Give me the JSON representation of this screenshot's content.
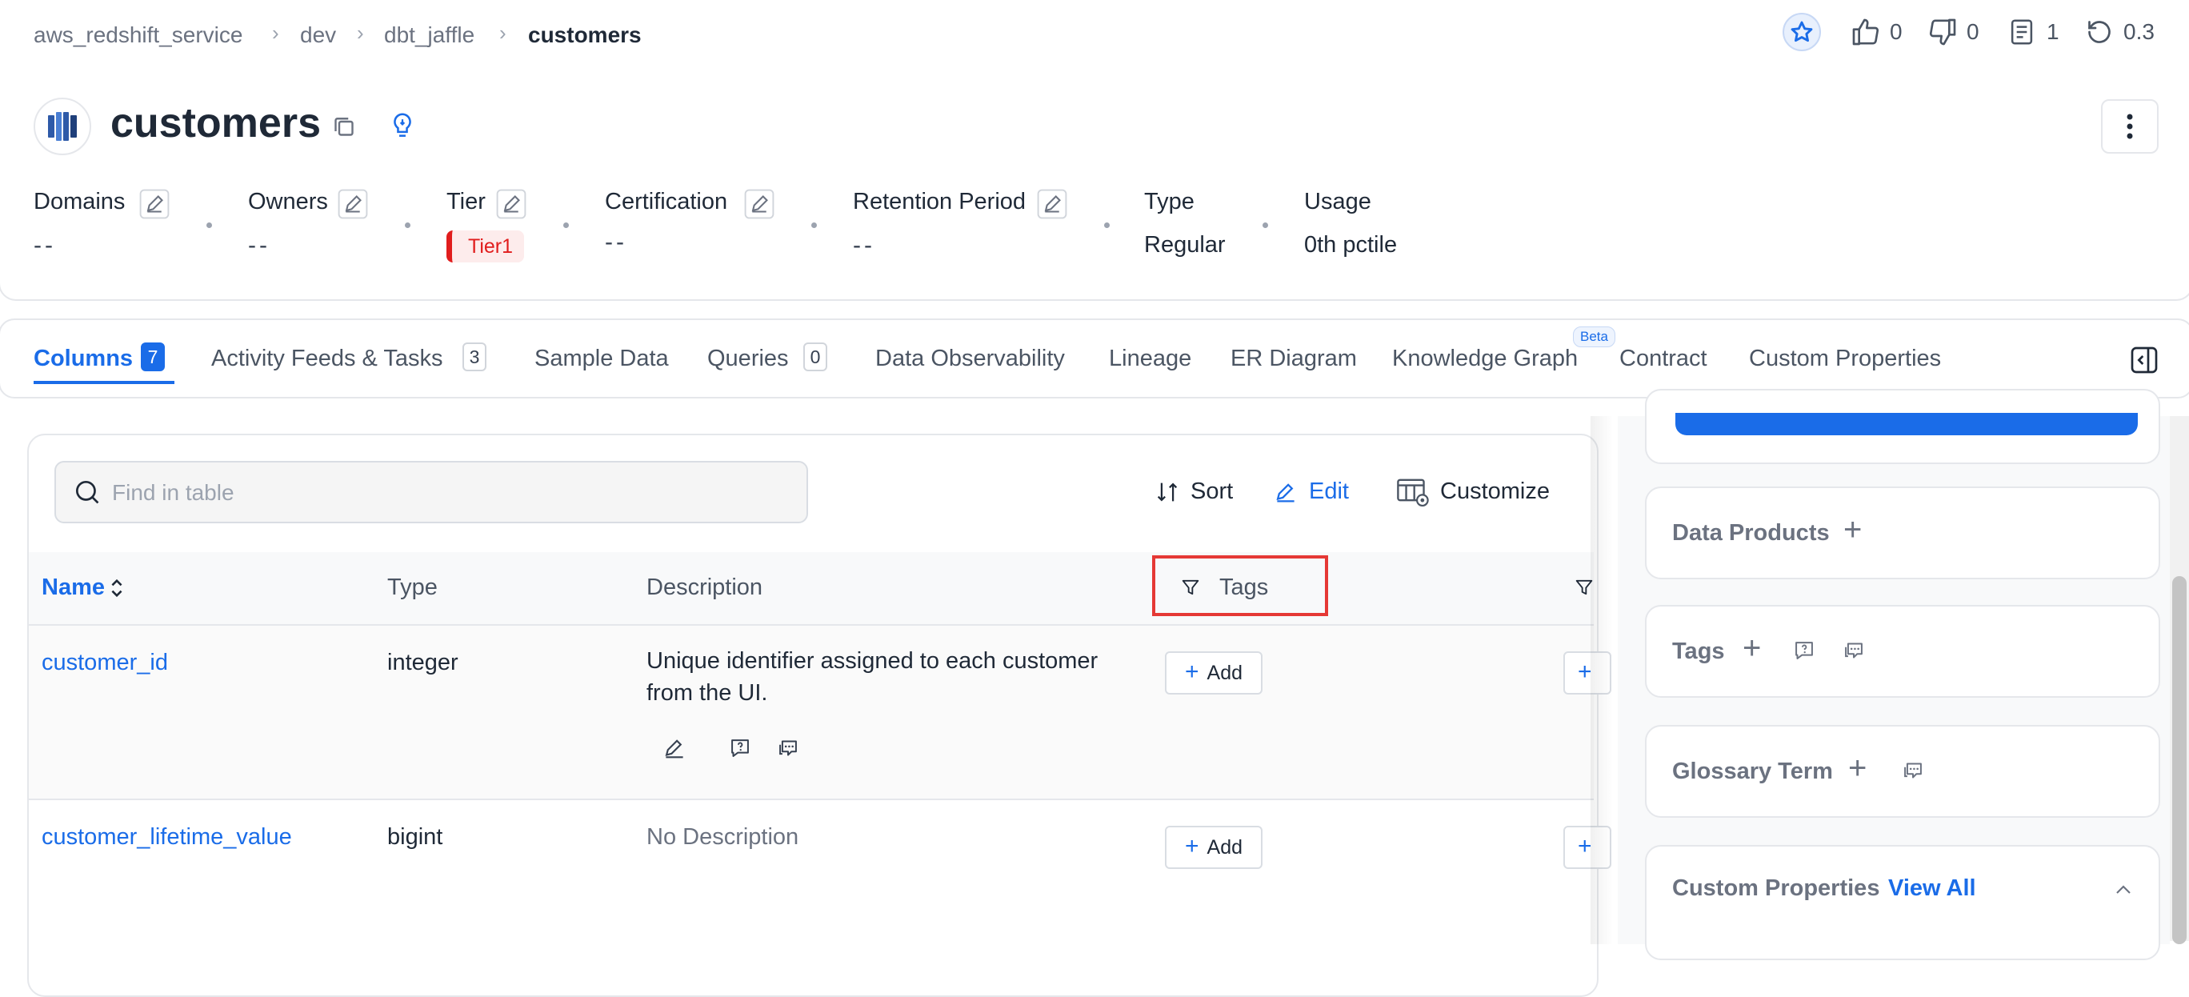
{
  "breadcrumb": {
    "items": [
      "aws_redshift_service",
      "dev",
      "dbt_jaffle"
    ],
    "current": "customers"
  },
  "topbar": {
    "likes": "0",
    "dislikes": "0",
    "tasks": "1",
    "version": "0.3"
  },
  "entity": {
    "title": "customers"
  },
  "meta": {
    "domains_label": "Domains",
    "domains_value": "--",
    "owners_label": "Owners",
    "owners_value": "--",
    "tier_label": "Tier",
    "tier_value": "Tier1",
    "certification_label": "Certification",
    "certification_value": "--",
    "retention_label": "Retention Period",
    "retention_value": "--",
    "type_label": "Type",
    "type_value": "Regular",
    "usage_label": "Usage",
    "usage_value": "0th pctile"
  },
  "tabs": [
    {
      "label": "Columns",
      "count": "7"
    },
    {
      "label": "Activity Feeds & Tasks",
      "count": "3"
    },
    {
      "label": "Sample Data"
    },
    {
      "label": "Queries",
      "count": "0"
    },
    {
      "label": "Data Observability"
    },
    {
      "label": "Lineage"
    },
    {
      "label": "ER Diagram"
    },
    {
      "label": "Knowledge Graph",
      "badge": "Beta"
    },
    {
      "label": "Contract"
    },
    {
      "label": "Custom Properties"
    }
  ],
  "toolbar": {
    "search_placeholder": "Find in table",
    "sort_label": "Sort",
    "edit_label": "Edit",
    "customize_label": "Customize"
  },
  "table": {
    "headers": {
      "name": "Name",
      "type": "Type",
      "description": "Description",
      "tags": "Tags"
    },
    "add_label": "Add",
    "rows": [
      {
        "name": "customer_id",
        "type": "integer",
        "description_line1": "Unique identifier assigned to each customer",
        "description_line2": "from the UI."
      },
      {
        "name": "customer_lifetime_value",
        "type": "bigint",
        "description": "No Description"
      }
    ]
  },
  "sidebar": {
    "data_products": "Data Products",
    "tags": "Tags",
    "glossary_term": "Glossary Term",
    "custom_properties": "Custom Properties",
    "view_all": "View All"
  },
  "colors": {
    "accent": "#1a6ce8",
    "tier_red": "#e11d1d",
    "highlight": "#e53935"
  }
}
